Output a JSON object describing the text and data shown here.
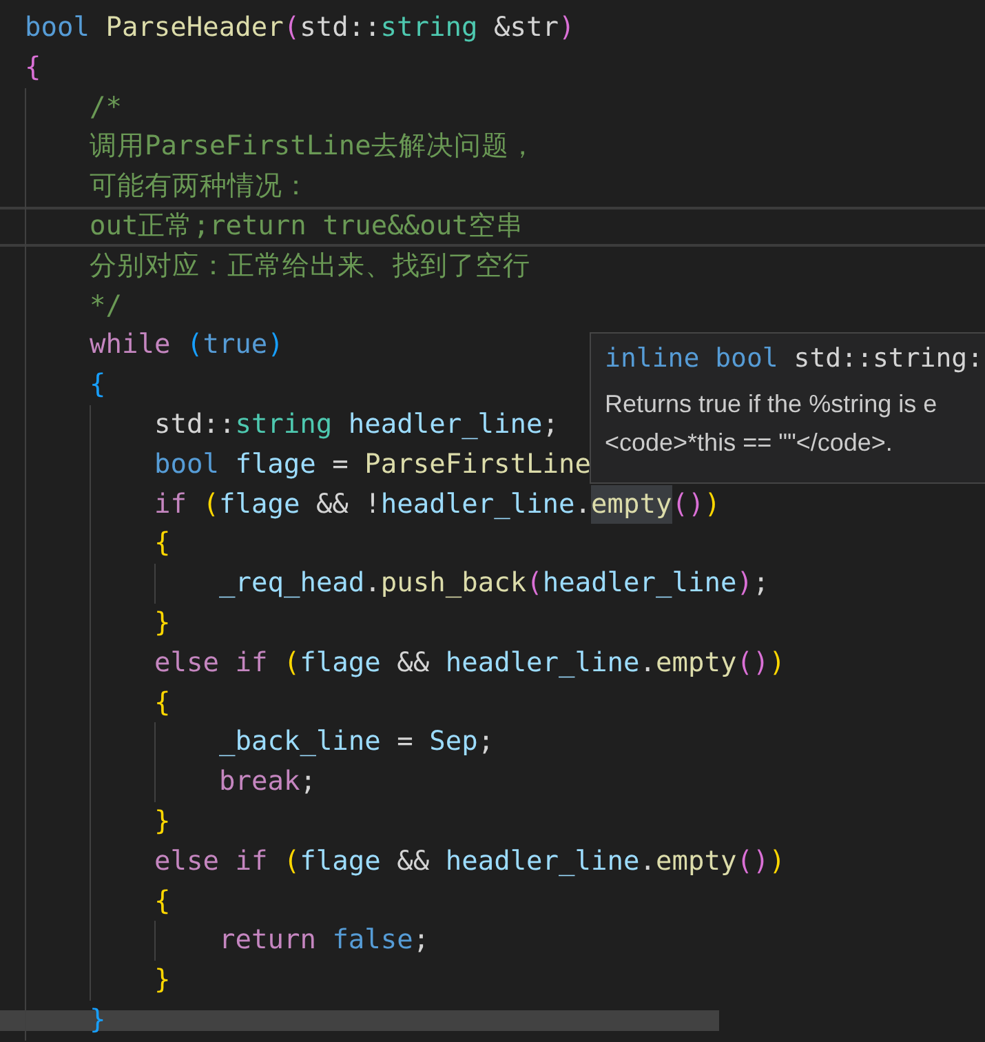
{
  "lines": [
    {
      "current": false,
      "tokens": [
        {
          "text": "bool ",
          "kind": "kw"
        },
        {
          "text": "ParseHeader",
          "kind": "fn"
        },
        {
          "text": "(",
          "kind": "b2"
        },
        {
          "text": "std::",
          "kind": "plain"
        },
        {
          "text": "string ",
          "kind": "type"
        },
        {
          "text": "&str",
          "kind": "plain"
        },
        {
          "text": ")",
          "kind": "b2"
        }
      ]
    },
    {
      "current": false,
      "tokens": [
        {
          "text": "{",
          "kind": "b2"
        }
      ]
    },
    {
      "current": false,
      "tokens": [
        {
          "text": "/*",
          "kind": "comment"
        }
      ]
    },
    {
      "current": false,
      "tokens": [
        {
          "text": "调用ParseFirstLine去解决问题，",
          "kind": "comment"
        }
      ]
    },
    {
      "current": false,
      "tokens": [
        {
          "text": "可能有两种情况：",
          "kind": "comment"
        }
      ]
    },
    {
      "current": true,
      "tokens": [
        {
          "text": "out正常;return true&&out空串",
          "kind": "comment"
        }
      ]
    },
    {
      "current": false,
      "tokens": [
        {
          "text": "分别对应：正常给出来、找到了空行",
          "kind": "comment"
        }
      ]
    },
    {
      "current": false,
      "tokens": [
        {
          "text": "*/",
          "kind": "comment"
        }
      ]
    },
    {
      "current": false,
      "tokens": [
        {
          "text": "while ",
          "kind": "ctrl"
        },
        {
          "text": "(",
          "kind": "b3"
        },
        {
          "text": "true",
          "kind": "kw"
        },
        {
          "text": ")",
          "kind": "b3"
        }
      ]
    },
    {
      "current": false,
      "tokens": [
        {
          "text": "{",
          "kind": "b3"
        }
      ]
    },
    {
      "current": false,
      "tokens": [
        {
          "text": "std::",
          "kind": "plain"
        },
        {
          "text": "string ",
          "kind": "type"
        },
        {
          "text": "headler_line",
          "kind": "var"
        },
        {
          "text": ";",
          "kind": "plain"
        }
      ]
    },
    {
      "current": false,
      "tokens": [
        {
          "text": "bool ",
          "kind": "kw"
        },
        {
          "text": "flage ",
          "kind": "var"
        },
        {
          "text": "= ",
          "kind": "plain"
        },
        {
          "text": "ParseFirstLine",
          "kind": "fn"
        }
      ]
    },
    {
      "current": false,
      "tokens": [
        {
          "text": "if ",
          "kind": "ctrl"
        },
        {
          "text": "(",
          "kind": "b1"
        },
        {
          "text": "flage ",
          "kind": "var"
        },
        {
          "text": "&& !",
          "kind": "plain"
        },
        {
          "text": "headler_line",
          "kind": "var"
        },
        {
          "text": ".",
          "kind": "plain"
        },
        {
          "text": "empty",
          "kind": "fn_hover"
        },
        {
          "text": "()",
          "kind": "b2"
        },
        {
          "text": ")",
          "kind": "b1"
        }
      ]
    },
    {
      "current": false,
      "tokens": [
        {
          "text": "{",
          "kind": "b1"
        }
      ]
    },
    {
      "current": false,
      "tokens": [
        {
          "text": "_req_head",
          "kind": "var"
        },
        {
          "text": ".",
          "kind": "plain"
        },
        {
          "text": "push_back",
          "kind": "fn"
        },
        {
          "text": "(",
          "kind": "b2"
        },
        {
          "text": "headler_line",
          "kind": "var"
        },
        {
          "text": ")",
          "kind": "b2"
        },
        {
          "text": ";",
          "kind": "plain"
        }
      ]
    },
    {
      "current": false,
      "tokens": [
        {
          "text": "}",
          "kind": "b1"
        }
      ]
    },
    {
      "current": false,
      "tokens": [
        {
          "text": "else if ",
          "kind": "ctrl"
        },
        {
          "text": "(",
          "kind": "b1"
        },
        {
          "text": "flage ",
          "kind": "var"
        },
        {
          "text": "&& ",
          "kind": "plain"
        },
        {
          "text": "headler_line",
          "kind": "var"
        },
        {
          "text": ".",
          "kind": "plain"
        },
        {
          "text": "empty",
          "kind": "fn"
        },
        {
          "text": "()",
          "kind": "b2"
        },
        {
          "text": ")",
          "kind": "b1"
        }
      ]
    },
    {
      "current": false,
      "tokens": [
        {
          "text": "{",
          "kind": "b1"
        }
      ]
    },
    {
      "current": false,
      "tokens": [
        {
          "text": "_back_line ",
          "kind": "var"
        },
        {
          "text": "= ",
          "kind": "plain"
        },
        {
          "text": "Sep",
          "kind": "var"
        },
        {
          "text": ";",
          "kind": "plain"
        }
      ]
    },
    {
      "current": false,
      "tokens": [
        {
          "text": "break",
          "kind": "ctrl"
        },
        {
          "text": ";",
          "kind": "plain"
        }
      ]
    },
    {
      "current": false,
      "tokens": [
        {
          "text": "}",
          "kind": "b1"
        }
      ]
    },
    {
      "current": false,
      "tokens": [
        {
          "text": "else if ",
          "kind": "ctrl"
        },
        {
          "text": "(",
          "kind": "b1"
        },
        {
          "text": "flage ",
          "kind": "var"
        },
        {
          "text": "&& ",
          "kind": "plain"
        },
        {
          "text": "headler_line",
          "kind": "var"
        },
        {
          "text": ".",
          "kind": "plain"
        },
        {
          "text": "empty",
          "kind": "fn"
        },
        {
          "text": "()",
          "kind": "b2"
        },
        {
          "text": ")",
          "kind": "b1"
        }
      ]
    },
    {
      "current": false,
      "tokens": [
        {
          "text": "{",
          "kind": "b1"
        }
      ]
    },
    {
      "current": false,
      "tokens": [
        {
          "text": "return ",
          "kind": "ctrl"
        },
        {
          "text": "false",
          "kind": "kw"
        },
        {
          "text": ";",
          "kind": "plain"
        }
      ]
    },
    {
      "current": false,
      "tokens": [
        {
          "text": "}",
          "kind": "b1"
        }
      ]
    },
    {
      "current": false,
      "tokens": [
        {
          "text": "}",
          "kind": "b3"
        }
      ]
    }
  ],
  "hover_tooltip": {
    "signature": [
      {
        "text": "inline bool ",
        "kind": "kw"
      },
      {
        "text": "std::string:",
        "kind": "plain"
      }
    ],
    "doc": [
      "Returns true if the %string is e",
      "<code>*this == \"\"</code>."
    ]
  }
}
